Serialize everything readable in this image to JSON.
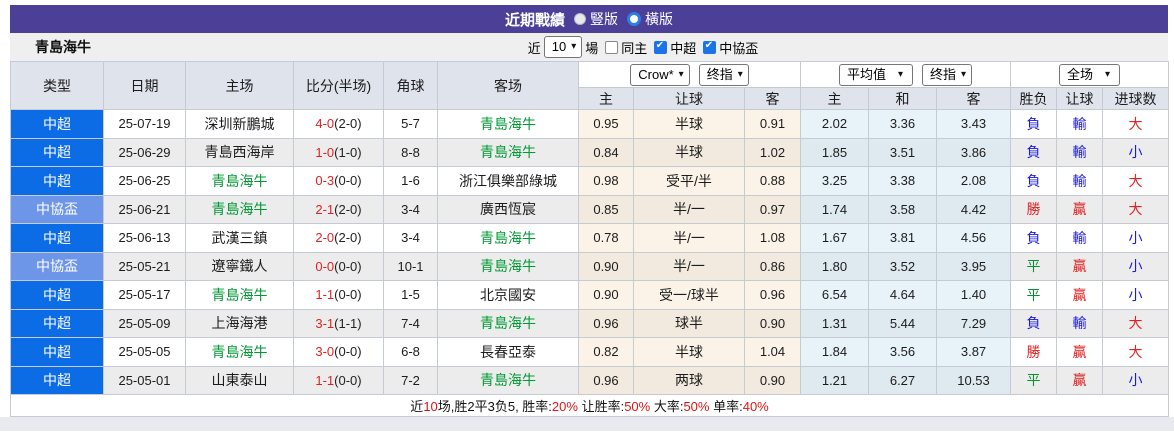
{
  "title_bar": {
    "title": "近期戰績",
    "radio_options": [
      {
        "label": "豎版",
        "selected": false
      },
      {
        "label": "橫版",
        "selected": true
      }
    ]
  },
  "filter_bar": {
    "team_name": "青島海牛",
    "near_label": "近",
    "matches_value": "10",
    "matches_label": "場",
    "checkboxes": [
      {
        "label": "同主",
        "checked": false
      },
      {
        "label": "中超",
        "checked": true
      },
      {
        "label": "中協盃",
        "checked": true
      }
    ]
  },
  "table": {
    "left_headers": [
      "类型",
      "日期",
      "主场",
      "比分(半场)",
      "角球",
      "客场"
    ],
    "odds_groups": [
      {
        "selects": [
          "Crow*",
          "终指"
        ],
        "sub_headers": [
          "主",
          "让球",
          "客"
        ]
      },
      {
        "selects": [
          "平均值",
          "终指"
        ],
        "sub_headers": [
          "主",
          "和",
          "客"
        ]
      },
      {
        "selects": [
          "全场"
        ],
        "sub_headers": [
          "胜负",
          "让球",
          "进球数"
        ]
      }
    ]
  },
  "rows": [
    {
      "league": "中超",
      "date": "25-07-19",
      "home": "深圳新鵬城",
      "score": "4-0",
      "half": "(2-0)",
      "corner": "5-7",
      "away": "青島海牛",
      "h_odds": "0.95",
      "handicap": "半球",
      "a_odds": "0.91",
      "avg_home": "2.02",
      "avg_draw": "3.36",
      "avg_away": "3.43",
      "result_wdl": "負",
      "result_handicap": "輸",
      "result_goals": "大"
    },
    {
      "league": "中超",
      "date": "25-06-29",
      "home": "青島西海岸",
      "score": "1-0",
      "half": "(1-0)",
      "corner": "8-8",
      "away": "青島海牛",
      "h_odds": "0.84",
      "handicap": "半球",
      "a_odds": "1.02",
      "avg_home": "1.85",
      "avg_draw": "3.51",
      "avg_away": "3.86",
      "result_wdl": "負",
      "result_handicap": "輸",
      "result_goals": "小"
    },
    {
      "league": "中超",
      "date": "25-06-25",
      "home": "青島海牛",
      "score": "0-3",
      "half": "(0-0)",
      "corner": "1-6",
      "away": "浙江俱樂部綠城",
      "h_odds": "0.98",
      "handicap": "受平/半",
      "a_odds": "0.88",
      "avg_home": "3.25",
      "avg_draw": "3.38",
      "avg_away": "2.08",
      "result_wdl": "負",
      "result_handicap": "輸",
      "result_goals": "大"
    },
    {
      "league": "中協盃",
      "date": "25-06-21",
      "home": "青島海牛",
      "score": "2-1",
      "half": "(2-0)",
      "corner": "3-4",
      "away": "廣西恆宸",
      "h_odds": "0.85",
      "handicap": "半/一",
      "a_odds": "0.97",
      "avg_home": "1.74",
      "avg_draw": "3.58",
      "avg_away": "4.42",
      "result_wdl": "勝",
      "result_handicap": "贏",
      "result_goals": "大"
    },
    {
      "league": "中超",
      "date": "25-06-13",
      "home": "武漢三鎮",
      "score": "2-0",
      "half": "(2-0)",
      "corner": "3-4",
      "away": "青島海牛",
      "h_odds": "0.78",
      "handicap": "半/一",
      "a_odds": "1.08",
      "avg_home": "1.67",
      "avg_draw": "3.81",
      "avg_away": "4.56",
      "result_wdl": "負",
      "result_handicap": "輸",
      "result_goals": "小"
    },
    {
      "league": "中協盃",
      "date": "25-05-21",
      "home": "遼寧鐵人",
      "score": "0-0",
      "half": "(0-0)",
      "corner": "10-1",
      "away": "青島海牛",
      "h_odds": "0.90",
      "handicap": "半/一",
      "a_odds": "0.86",
      "avg_home": "1.80",
      "avg_draw": "3.52",
      "avg_away": "3.95",
      "result_wdl": "平",
      "result_handicap": "贏",
      "result_goals": "小"
    },
    {
      "league": "中超",
      "date": "25-05-17",
      "home": "青島海牛",
      "score": "1-1",
      "half": "(0-0)",
      "corner": "1-5",
      "away": "北京國安",
      "h_odds": "0.90",
      "handicap": "受一/球半",
      "a_odds": "0.96",
      "avg_home": "6.54",
      "avg_draw": "4.64",
      "avg_away": "1.40",
      "result_wdl": "平",
      "result_handicap": "贏",
      "result_goals": "小"
    },
    {
      "league": "中超",
      "date": "25-05-09",
      "home": "上海海港",
      "score": "3-1",
      "half": "(1-1)",
      "corner": "7-4",
      "away": "青島海牛",
      "h_odds": "0.96",
      "handicap": "球半",
      "a_odds": "0.90",
      "avg_home": "1.31",
      "avg_draw": "5.44",
      "avg_away": "7.29",
      "result_wdl": "負",
      "result_handicap": "輸",
      "result_goals": "大"
    },
    {
      "league": "中超",
      "date": "25-05-05",
      "home": "青島海牛",
      "score": "3-0",
      "half": "(0-0)",
      "corner": "6-8",
      "away": "長春亞泰",
      "h_odds": "0.82",
      "handicap": "半球",
      "a_odds": "1.04",
      "avg_home": "1.84",
      "avg_draw": "3.56",
      "avg_away": "3.87",
      "result_wdl": "勝",
      "result_handicap": "贏",
      "result_goals": "大"
    },
    {
      "league": "中超",
      "date": "25-05-01",
      "home": "山東泰山",
      "score": "1-1",
      "half": "(0-0)",
      "corner": "7-2",
      "away": "青島海牛",
      "h_odds": "0.96",
      "handicap": "两球",
      "a_odds": "0.90",
      "avg_home": "1.21",
      "avg_draw": "6.27",
      "avg_away": "10.53",
      "result_wdl": "平",
      "result_handicap": "贏",
      "result_goals": "小"
    }
  ],
  "footer": {
    "segments": [
      "近",
      "10",
      "场,胜2平3负5, 胜率:",
      "20%",
      " 让胜率:",
      "50%",
      " 大率:",
      "50%",
      " 单率:",
      "40%"
    ]
  },
  "colors": {
    "header_purple": "#4b3f97",
    "league": {
      "中超": "#0b6ce6",
      "中協盃": "#6e96e8"
    },
    "self_team_green": "#009933",
    "win_red": "#df2222",
    "lose_blue": "#1a1ada",
    "draw_green": "#0a9030",
    "odds_cream": "#fbf3e8",
    "avg_blue": "#e8f3f9"
  }
}
